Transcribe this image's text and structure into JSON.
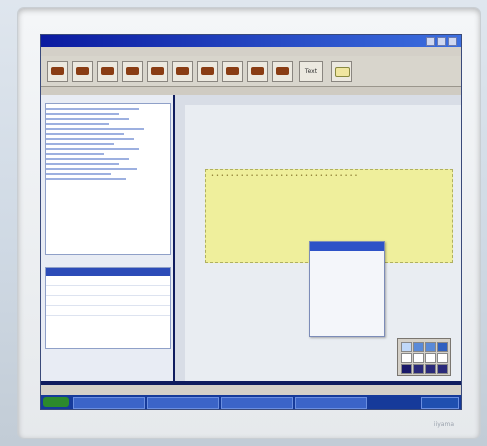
{
  "monitor": {
    "brand_bottom": "iiyama"
  },
  "toolbar": {
    "text_button_label": "Text"
  }
}
